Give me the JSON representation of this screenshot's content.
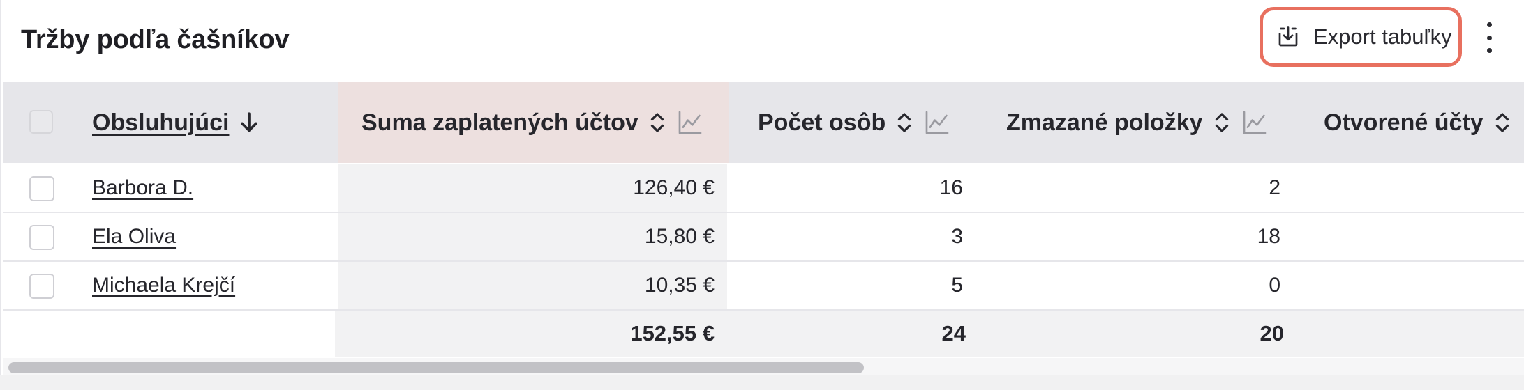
{
  "header": {
    "title": "Tržby podľa čašníkov",
    "export_label": "Export tabuľky"
  },
  "table": {
    "columns": [
      {
        "label": "Obsluhujúci",
        "sort": "desc",
        "chart": false
      },
      {
        "label": "Suma zaplatených účtov",
        "sort": "both",
        "chart": true,
        "active": true
      },
      {
        "label": "Počet osôb",
        "sort": "both",
        "chart": true
      },
      {
        "label": "Zmazané položky",
        "sort": "both",
        "chart": true
      },
      {
        "label": "Otvorené účty",
        "sort": "both",
        "chart": false
      }
    ],
    "rows": [
      {
        "name": "Barbora D.",
        "sum": "126,40 €",
        "persons": "16",
        "deleted": "2"
      },
      {
        "name": "Ela Oliva",
        "sum": "15,80 €",
        "persons": "3",
        "deleted": "18"
      },
      {
        "name": "Michaela Krejčí",
        "sum": "10,35 €",
        "persons": "5",
        "deleted": "0"
      }
    ],
    "totals": {
      "sum": "152,55 €",
      "persons": "24",
      "deleted": "20"
    }
  },
  "icons": {
    "export": "download-icon",
    "menu": "kebab-menu-icon",
    "sort_desc": "arrow-down-icon",
    "sort_both": "sort-up-down-icon",
    "chart": "line-chart-icon"
  },
  "colors": {
    "accent_outline": "#e8705f",
    "header_bg": "#e6e6ea",
    "active_header_bg": "#ede0df"
  }
}
